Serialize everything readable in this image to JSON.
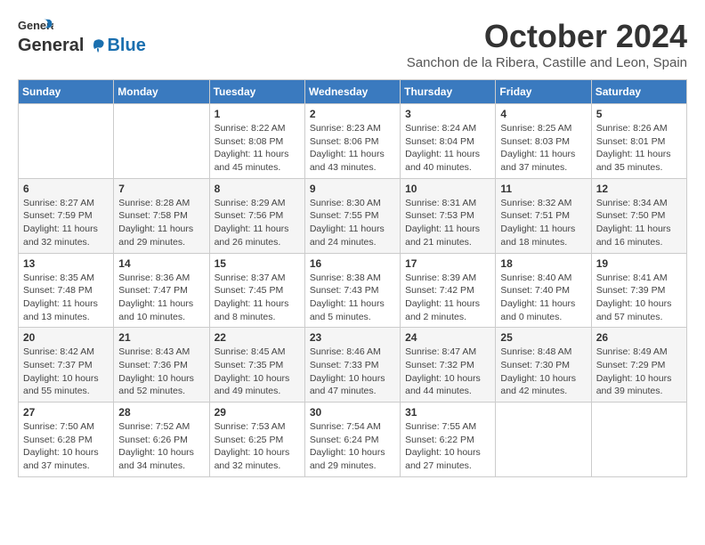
{
  "header": {
    "logo_general": "General",
    "logo_blue": "Blue",
    "month_title": "October 2024",
    "subtitle": "Sanchon de la Ribera, Castille and Leon, Spain"
  },
  "calendar": {
    "days_of_week": [
      "Sunday",
      "Monday",
      "Tuesday",
      "Wednesday",
      "Thursday",
      "Friday",
      "Saturday"
    ],
    "weeks": [
      [
        null,
        null,
        {
          "day": "1",
          "sunrise": "Sunrise: 8:22 AM",
          "sunset": "Sunset: 8:08 PM",
          "daylight": "Daylight: 11 hours and 45 minutes."
        },
        {
          "day": "2",
          "sunrise": "Sunrise: 8:23 AM",
          "sunset": "Sunset: 8:06 PM",
          "daylight": "Daylight: 11 hours and 43 minutes."
        },
        {
          "day": "3",
          "sunrise": "Sunrise: 8:24 AM",
          "sunset": "Sunset: 8:04 PM",
          "daylight": "Daylight: 11 hours and 40 minutes."
        },
        {
          "day": "4",
          "sunrise": "Sunrise: 8:25 AM",
          "sunset": "Sunset: 8:03 PM",
          "daylight": "Daylight: 11 hours and 37 minutes."
        },
        {
          "day": "5",
          "sunrise": "Sunrise: 8:26 AM",
          "sunset": "Sunset: 8:01 PM",
          "daylight": "Daylight: 11 hours and 35 minutes."
        }
      ],
      [
        {
          "day": "6",
          "sunrise": "Sunrise: 8:27 AM",
          "sunset": "Sunset: 7:59 PM",
          "daylight": "Daylight: 11 hours and 32 minutes."
        },
        {
          "day": "7",
          "sunrise": "Sunrise: 8:28 AM",
          "sunset": "Sunset: 7:58 PM",
          "daylight": "Daylight: 11 hours and 29 minutes."
        },
        {
          "day": "8",
          "sunrise": "Sunrise: 8:29 AM",
          "sunset": "Sunset: 7:56 PM",
          "daylight": "Daylight: 11 hours and 26 minutes."
        },
        {
          "day": "9",
          "sunrise": "Sunrise: 8:30 AM",
          "sunset": "Sunset: 7:55 PM",
          "daylight": "Daylight: 11 hours and 24 minutes."
        },
        {
          "day": "10",
          "sunrise": "Sunrise: 8:31 AM",
          "sunset": "Sunset: 7:53 PM",
          "daylight": "Daylight: 11 hours and 21 minutes."
        },
        {
          "day": "11",
          "sunrise": "Sunrise: 8:32 AM",
          "sunset": "Sunset: 7:51 PM",
          "daylight": "Daylight: 11 hours and 18 minutes."
        },
        {
          "day": "12",
          "sunrise": "Sunrise: 8:34 AM",
          "sunset": "Sunset: 7:50 PM",
          "daylight": "Daylight: 11 hours and 16 minutes."
        }
      ],
      [
        {
          "day": "13",
          "sunrise": "Sunrise: 8:35 AM",
          "sunset": "Sunset: 7:48 PM",
          "daylight": "Daylight: 11 hours and 13 minutes."
        },
        {
          "day": "14",
          "sunrise": "Sunrise: 8:36 AM",
          "sunset": "Sunset: 7:47 PM",
          "daylight": "Daylight: 11 hours and 10 minutes."
        },
        {
          "day": "15",
          "sunrise": "Sunrise: 8:37 AM",
          "sunset": "Sunset: 7:45 PM",
          "daylight": "Daylight: 11 hours and 8 minutes."
        },
        {
          "day": "16",
          "sunrise": "Sunrise: 8:38 AM",
          "sunset": "Sunset: 7:43 PM",
          "daylight": "Daylight: 11 hours and 5 minutes."
        },
        {
          "day": "17",
          "sunrise": "Sunrise: 8:39 AM",
          "sunset": "Sunset: 7:42 PM",
          "daylight": "Daylight: 11 hours and 2 minutes."
        },
        {
          "day": "18",
          "sunrise": "Sunrise: 8:40 AM",
          "sunset": "Sunset: 7:40 PM",
          "daylight": "Daylight: 11 hours and 0 minutes."
        },
        {
          "day": "19",
          "sunrise": "Sunrise: 8:41 AM",
          "sunset": "Sunset: 7:39 PM",
          "daylight": "Daylight: 10 hours and 57 minutes."
        }
      ],
      [
        {
          "day": "20",
          "sunrise": "Sunrise: 8:42 AM",
          "sunset": "Sunset: 7:37 PM",
          "daylight": "Daylight: 10 hours and 55 minutes."
        },
        {
          "day": "21",
          "sunrise": "Sunrise: 8:43 AM",
          "sunset": "Sunset: 7:36 PM",
          "daylight": "Daylight: 10 hours and 52 minutes."
        },
        {
          "day": "22",
          "sunrise": "Sunrise: 8:45 AM",
          "sunset": "Sunset: 7:35 PM",
          "daylight": "Daylight: 10 hours and 49 minutes."
        },
        {
          "day": "23",
          "sunrise": "Sunrise: 8:46 AM",
          "sunset": "Sunset: 7:33 PM",
          "daylight": "Daylight: 10 hours and 47 minutes."
        },
        {
          "day": "24",
          "sunrise": "Sunrise: 8:47 AM",
          "sunset": "Sunset: 7:32 PM",
          "daylight": "Daylight: 10 hours and 44 minutes."
        },
        {
          "day": "25",
          "sunrise": "Sunrise: 8:48 AM",
          "sunset": "Sunset: 7:30 PM",
          "daylight": "Daylight: 10 hours and 42 minutes."
        },
        {
          "day": "26",
          "sunrise": "Sunrise: 8:49 AM",
          "sunset": "Sunset: 7:29 PM",
          "daylight": "Daylight: 10 hours and 39 minutes."
        }
      ],
      [
        {
          "day": "27",
          "sunrise": "Sunrise: 7:50 AM",
          "sunset": "Sunset: 6:28 PM",
          "daylight": "Daylight: 10 hours and 37 minutes."
        },
        {
          "day": "28",
          "sunrise": "Sunrise: 7:52 AM",
          "sunset": "Sunset: 6:26 PM",
          "daylight": "Daylight: 10 hours and 34 minutes."
        },
        {
          "day": "29",
          "sunrise": "Sunrise: 7:53 AM",
          "sunset": "Sunset: 6:25 PM",
          "daylight": "Daylight: 10 hours and 32 minutes."
        },
        {
          "day": "30",
          "sunrise": "Sunrise: 7:54 AM",
          "sunset": "Sunset: 6:24 PM",
          "daylight": "Daylight: 10 hours and 29 minutes."
        },
        {
          "day": "31",
          "sunrise": "Sunrise: 7:55 AM",
          "sunset": "Sunset: 6:22 PM",
          "daylight": "Daylight: 10 hours and 27 minutes."
        },
        null,
        null
      ]
    ]
  }
}
